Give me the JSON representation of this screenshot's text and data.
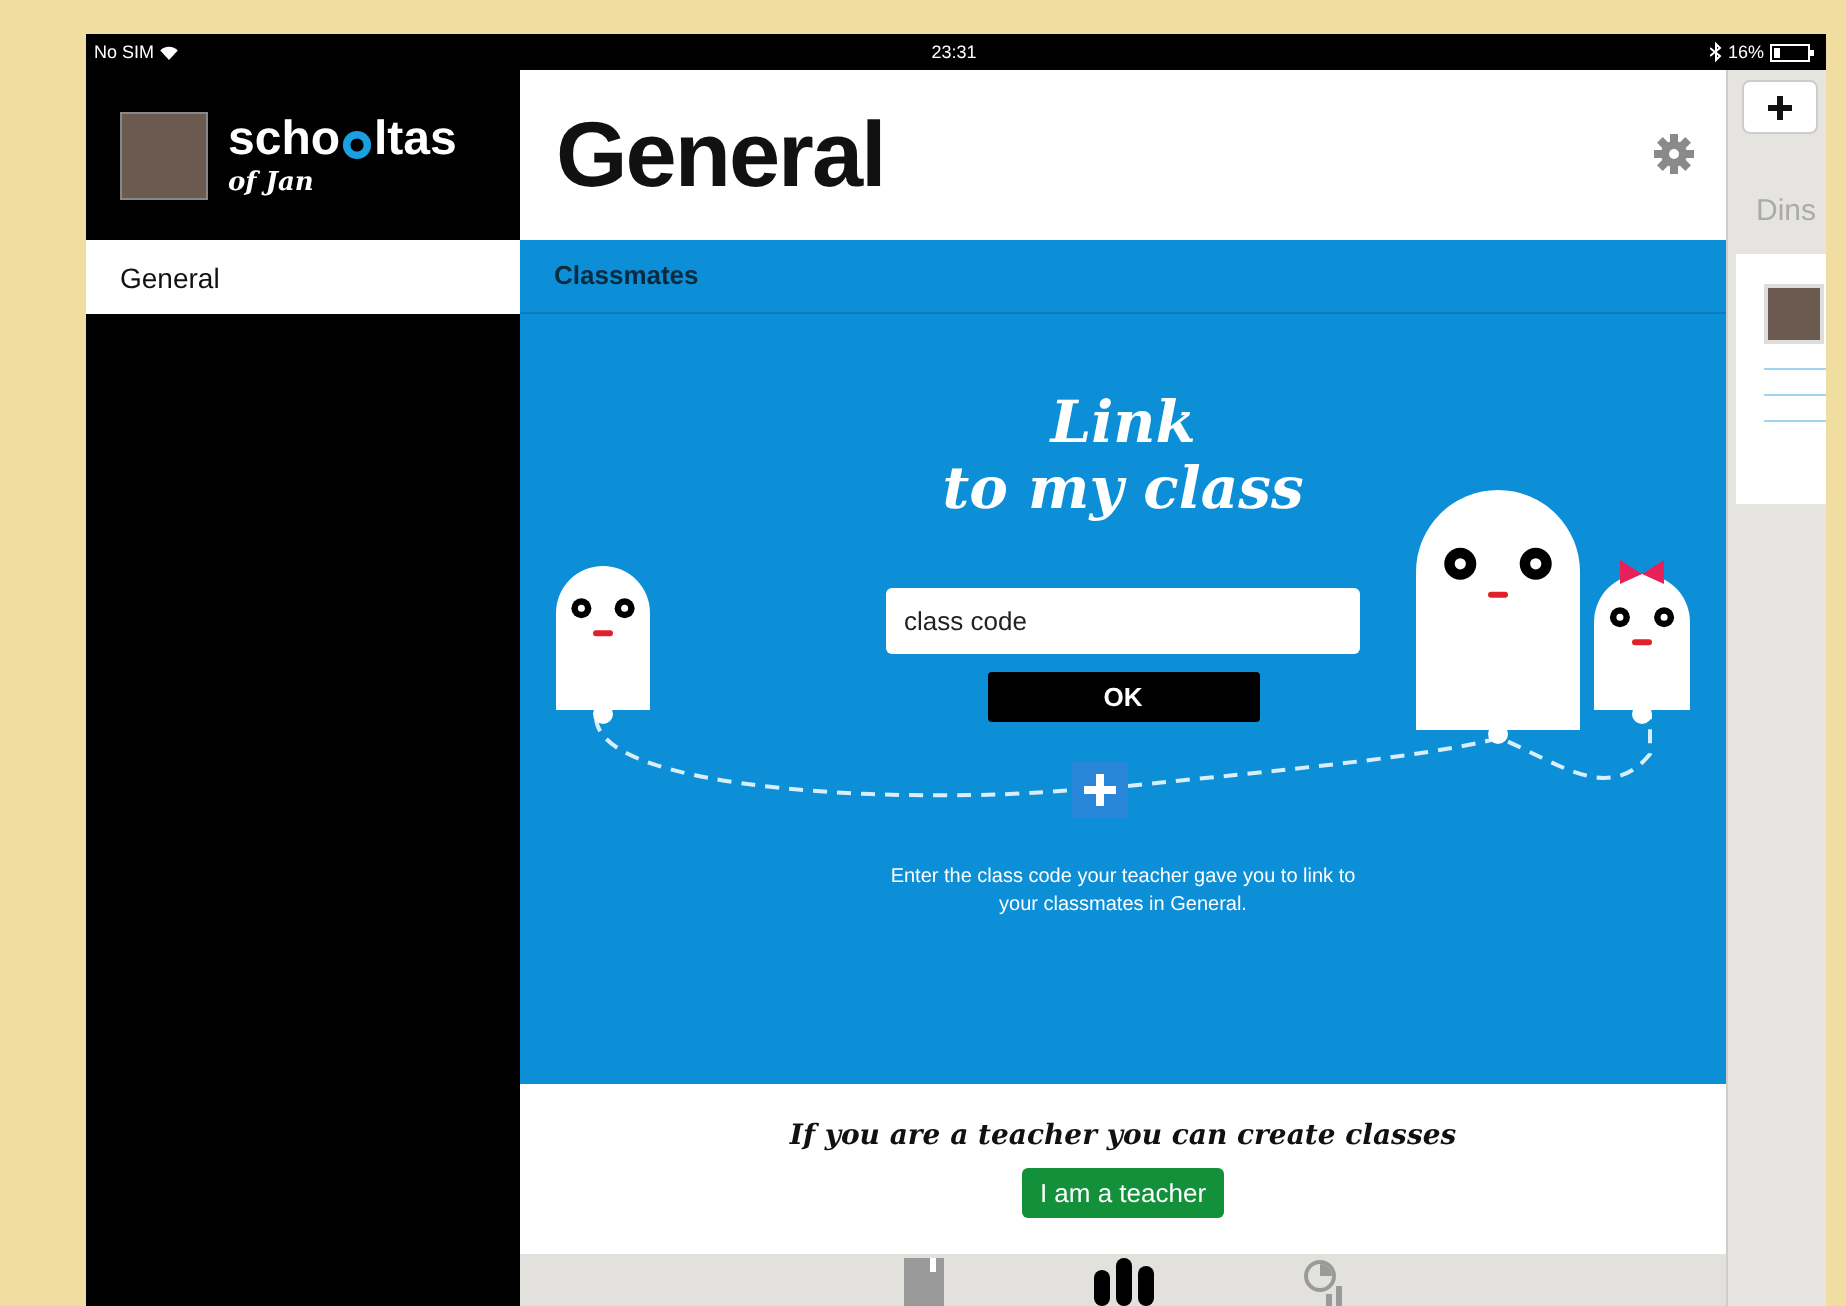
{
  "status_bar": {
    "carrier": "No SIM",
    "time": "23:31",
    "battery": "16%"
  },
  "sidebar": {
    "logo": {
      "before": "scho",
      "after": "ltas"
    },
    "owner": "of Jan",
    "items": [
      {
        "label": "General",
        "selected": true
      }
    ]
  },
  "header": {
    "title": "General"
  },
  "section": {
    "title": "Classmates"
  },
  "link_panel": {
    "title_line_1": "Link",
    "title_line_2": "to my class",
    "code_field": {
      "placeholder": "class code"
    },
    "ok_button": "OK",
    "hint": "Enter the class code your teacher gave you to link to your classmates in General."
  },
  "teacher": {
    "text": "If you are a teacher you can create classes",
    "button": "I am a teacher"
  },
  "tab_bar": [
    {
      "kind": "book",
      "selected": false
    },
    {
      "kind": "hand",
      "selected": true
    },
    {
      "kind": "stats",
      "selected": false
    }
  ],
  "right_panel": {
    "heading": "Dins"
  }
}
